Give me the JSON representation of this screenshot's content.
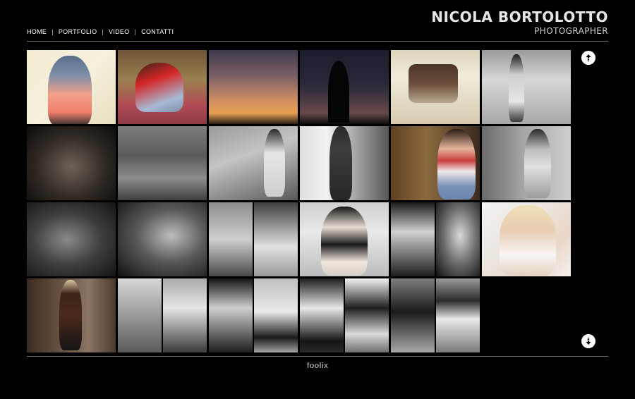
{
  "brand": {
    "name": "NICOLA BORTOLOTTO",
    "subtitle": "PHOTOGRAPHER"
  },
  "nav": {
    "items": [
      {
        "label": "HOME"
      },
      {
        "label": "PORTFOLIO"
      },
      {
        "label": "VIDEO"
      },
      {
        "label": "CONTATTI"
      }
    ],
    "separator": "|"
  },
  "footer": {
    "logo_text": "foolix"
  },
  "colors": {
    "background": "#000000",
    "rule": "#6f6f6f",
    "text": "#ffffff"
  },
  "icons": {
    "scroll_up": "scroll-up-icon",
    "scroll_down": "scroll-down-icon"
  }
}
